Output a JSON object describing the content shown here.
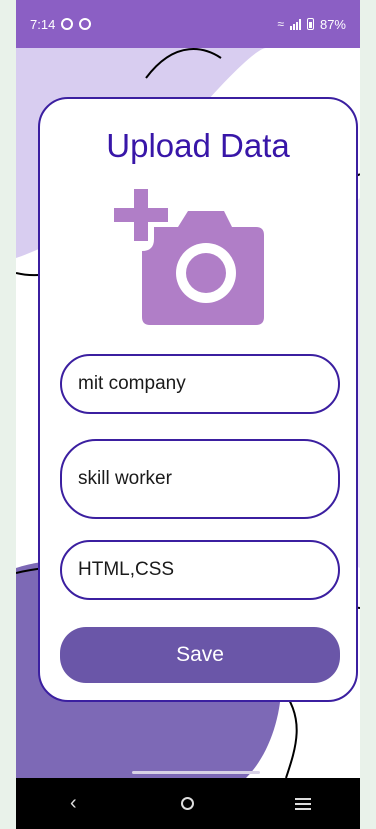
{
  "status_bar": {
    "time": "7:14",
    "battery": "87%"
  },
  "form": {
    "title": "Upload Data",
    "fields": [
      {
        "value": "mit company"
      },
      {
        "value": "skill worker"
      },
      {
        "value": "HTML,CSS"
      }
    ],
    "save_label": "Save"
  },
  "colors": {
    "accent": "#3b1fa0",
    "button": "#6a56a8",
    "camera": "#b07ec7",
    "status_bar": "#8b5fc4"
  },
  "icons": {
    "camera": "add-photo-icon",
    "back": "back-icon",
    "home": "home-icon",
    "recents": "recents-icon"
  }
}
